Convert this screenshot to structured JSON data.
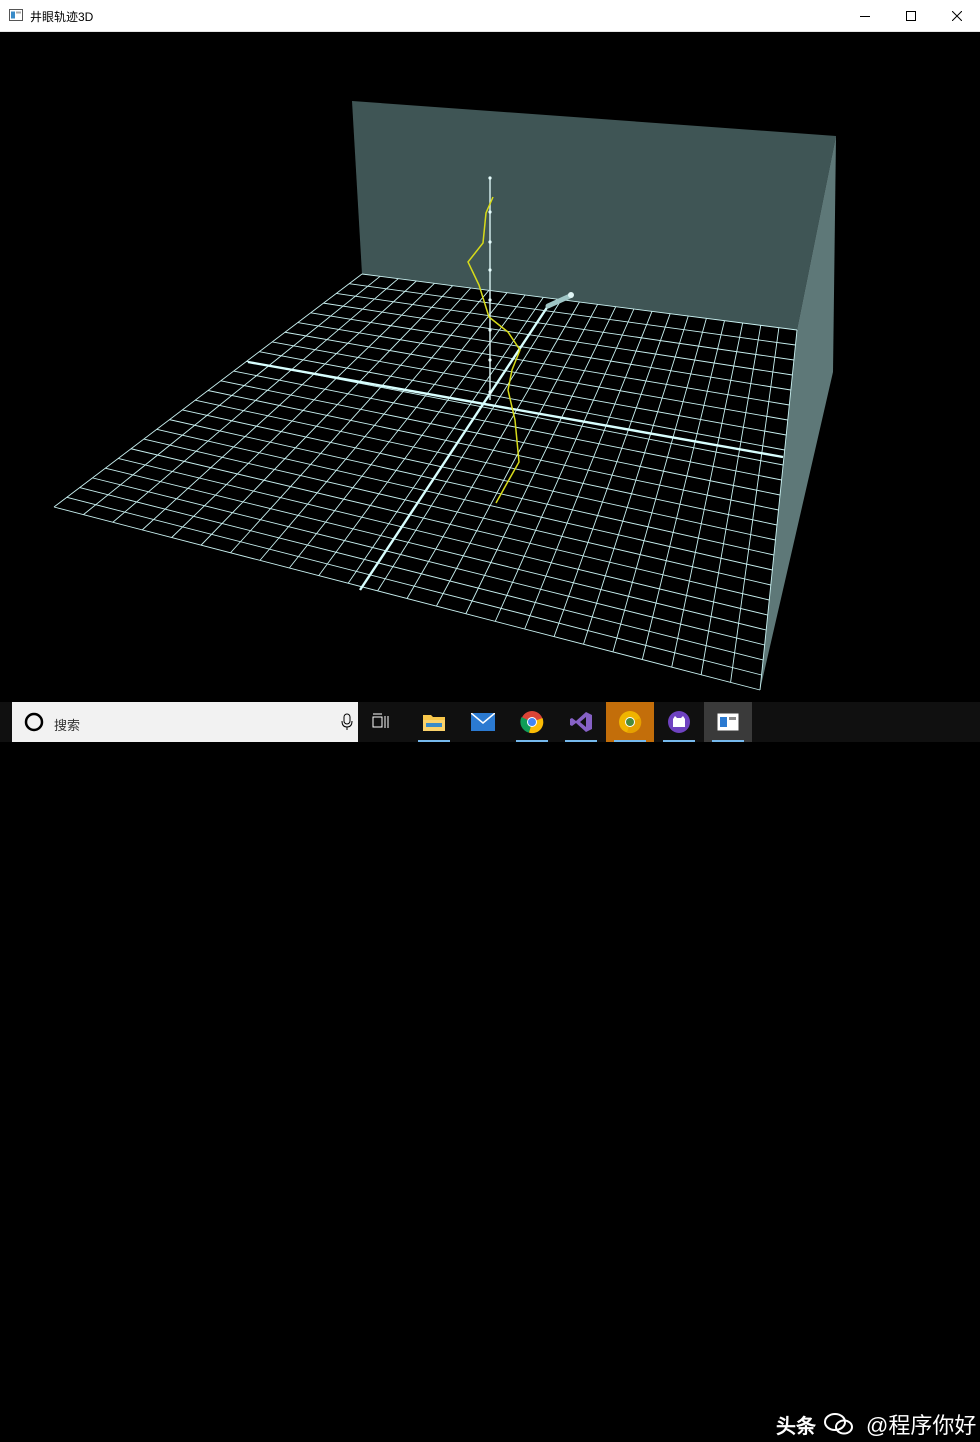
{
  "window": {
    "title": "井眼轨迹3D",
    "icon": "app-window-icon",
    "controls": [
      "minimize-icon",
      "maximize-icon",
      "close-icon"
    ]
  },
  "scene": {
    "background": "#000000",
    "wall_color": "#3f5555",
    "side_wall_color": "#5e7878",
    "grid_color": "#c9f1f1",
    "axis_color": "#d8ffff",
    "trajectory_color": "#d7db1a"
  },
  "taskbar": {
    "search_placeholder": "搜索",
    "apps": [
      {
        "name": "task-view-icon"
      },
      {
        "name": "file-explorer-icon"
      },
      {
        "name": "mail-icon"
      },
      {
        "name": "chrome-icon"
      },
      {
        "name": "visual-studio-icon"
      },
      {
        "name": "chrome-canary-icon"
      },
      {
        "name": "github-desktop-icon"
      },
      {
        "name": "wellbore-app-icon"
      }
    ]
  },
  "watermark": {
    "text1": "头条",
    "text2": "@程序你好"
  }
}
